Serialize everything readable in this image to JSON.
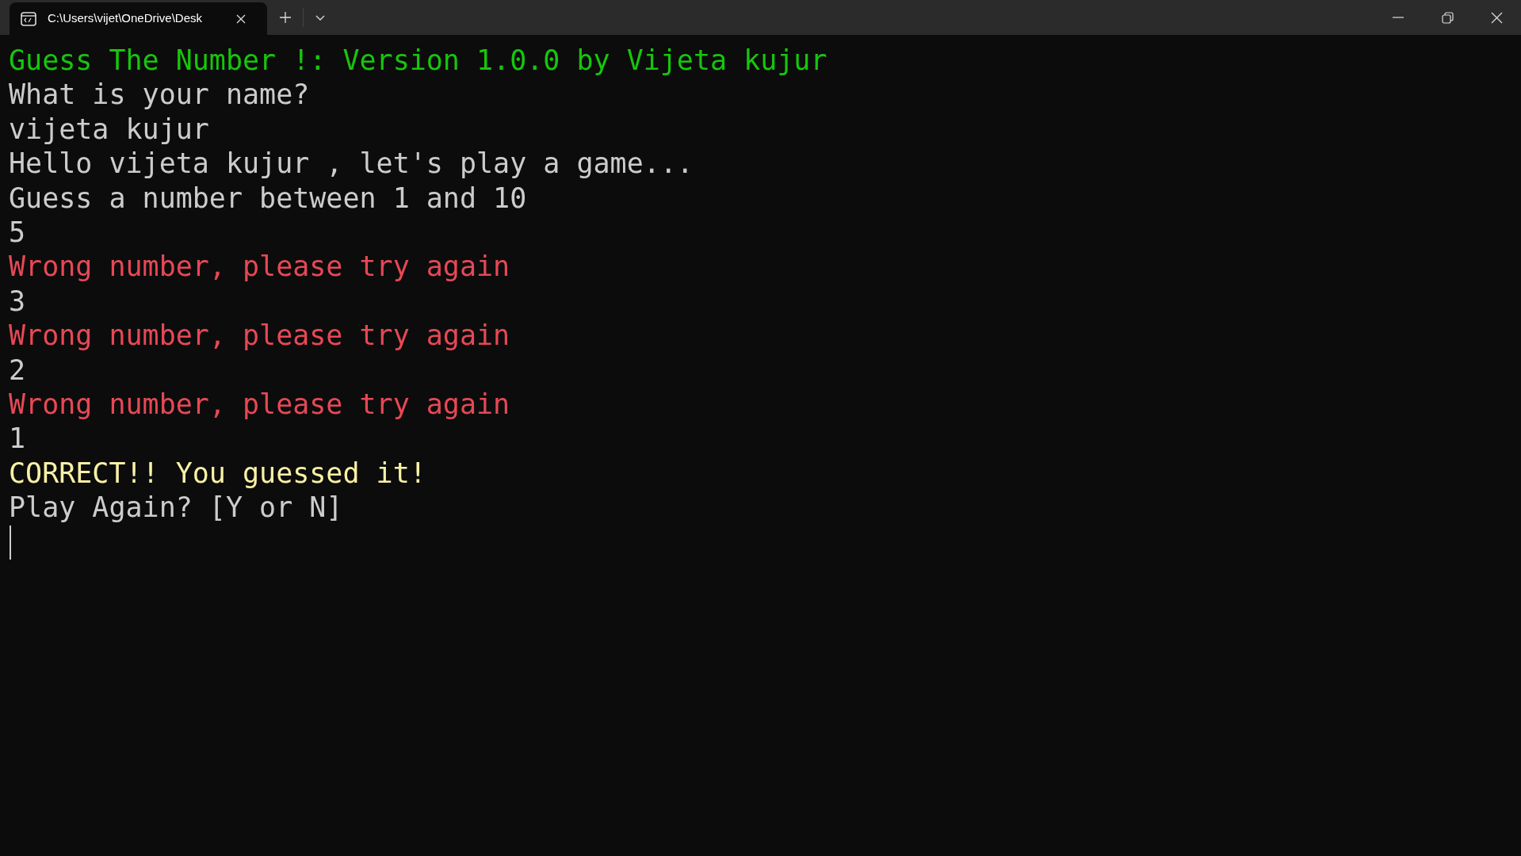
{
  "tab": {
    "title": "C:\\Users\\vijet\\OneDrive\\Desk",
    "selected": true
  },
  "console": [
    {
      "kind": "banner",
      "text": "Guess The Number !: Version 1.0.0 by Vijeta kujur"
    },
    {
      "kind": "output",
      "text": "What is your name?"
    },
    {
      "kind": "input",
      "text": "vijeta kujur"
    },
    {
      "kind": "output",
      "text": "Hello vijeta kujur , let's play a game..."
    },
    {
      "kind": "output",
      "text": "Guess a number between 1 and 10"
    },
    {
      "kind": "input",
      "text": "5"
    },
    {
      "kind": "error",
      "text": "Wrong number, please try again"
    },
    {
      "kind": "input",
      "text": "3"
    },
    {
      "kind": "error",
      "text": "Wrong number, please try again"
    },
    {
      "kind": "input",
      "text": "2"
    },
    {
      "kind": "error",
      "text": "Wrong number, please try again"
    },
    {
      "kind": "input",
      "text": "1"
    },
    {
      "kind": "success",
      "text": "CORRECT!! You guessed it!"
    },
    {
      "kind": "output",
      "text": "Play Again? [Y or N]"
    }
  ]
}
